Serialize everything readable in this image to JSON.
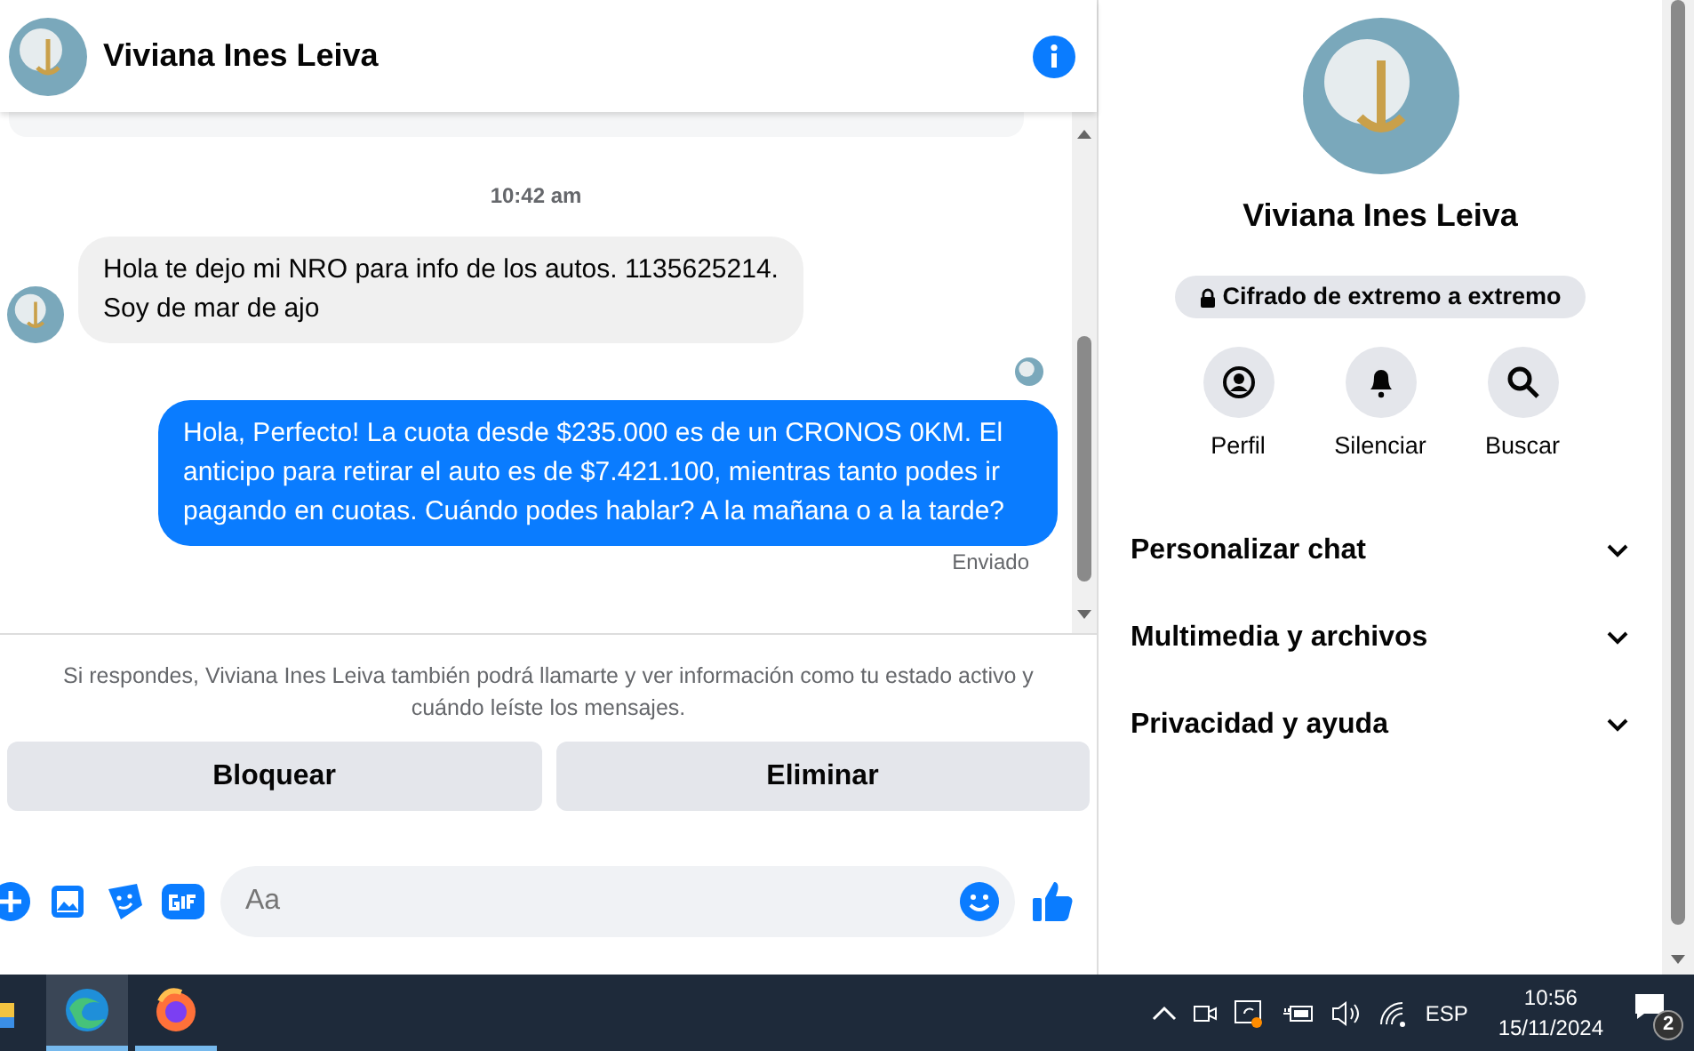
{
  "chat": {
    "title": "Viviana Ines Leiva",
    "timestamp": "10:42 am",
    "messages": [
      {
        "kind": "incoming",
        "text": "Hola te dejo mi NRO para info de los autos. 1135625214.\nSoy de mar de ajo"
      },
      {
        "kind": "outgoing",
        "text": "Hola, Perfecto! La cuota desde $235.000 es de un CRONOS 0KM. El anticipo para retirar el auto es de $7.421.100, mientras tanto podes ir pagando en cuotas. Cuándo podes hablar? A la mañana o a la tarde?",
        "status": "Enviado"
      }
    ],
    "notice": "Si respondes, Viviana Ines Leiva también podrá llamarte y ver información como tu estado activo y cuándo leíste los mensajes.",
    "actions": [
      "Bloquear",
      "Eliminar"
    ],
    "composer": {
      "placeholder": "Aa"
    }
  },
  "details": {
    "name": "Viviana Ines Leiva",
    "encryption": "Cifrado de extremo a extremo",
    "quick_actions": [
      {
        "kind": "profile",
        "label": "Perfil"
      },
      {
        "kind": "mute",
        "label": "Silenciar"
      },
      {
        "kind": "search",
        "label": "Buscar"
      }
    ],
    "sections": [
      {
        "label": "Personalizar chat",
        "expanded": false
      },
      {
        "label": "Multimedia y archivos",
        "expanded": false
      },
      {
        "label": "Privacidad y ayuda",
        "expanded": false
      }
    ]
  },
  "taskbar": {
    "language": "ESP",
    "time": "10:56",
    "date": "15/11/2024",
    "notifications": "2"
  }
}
